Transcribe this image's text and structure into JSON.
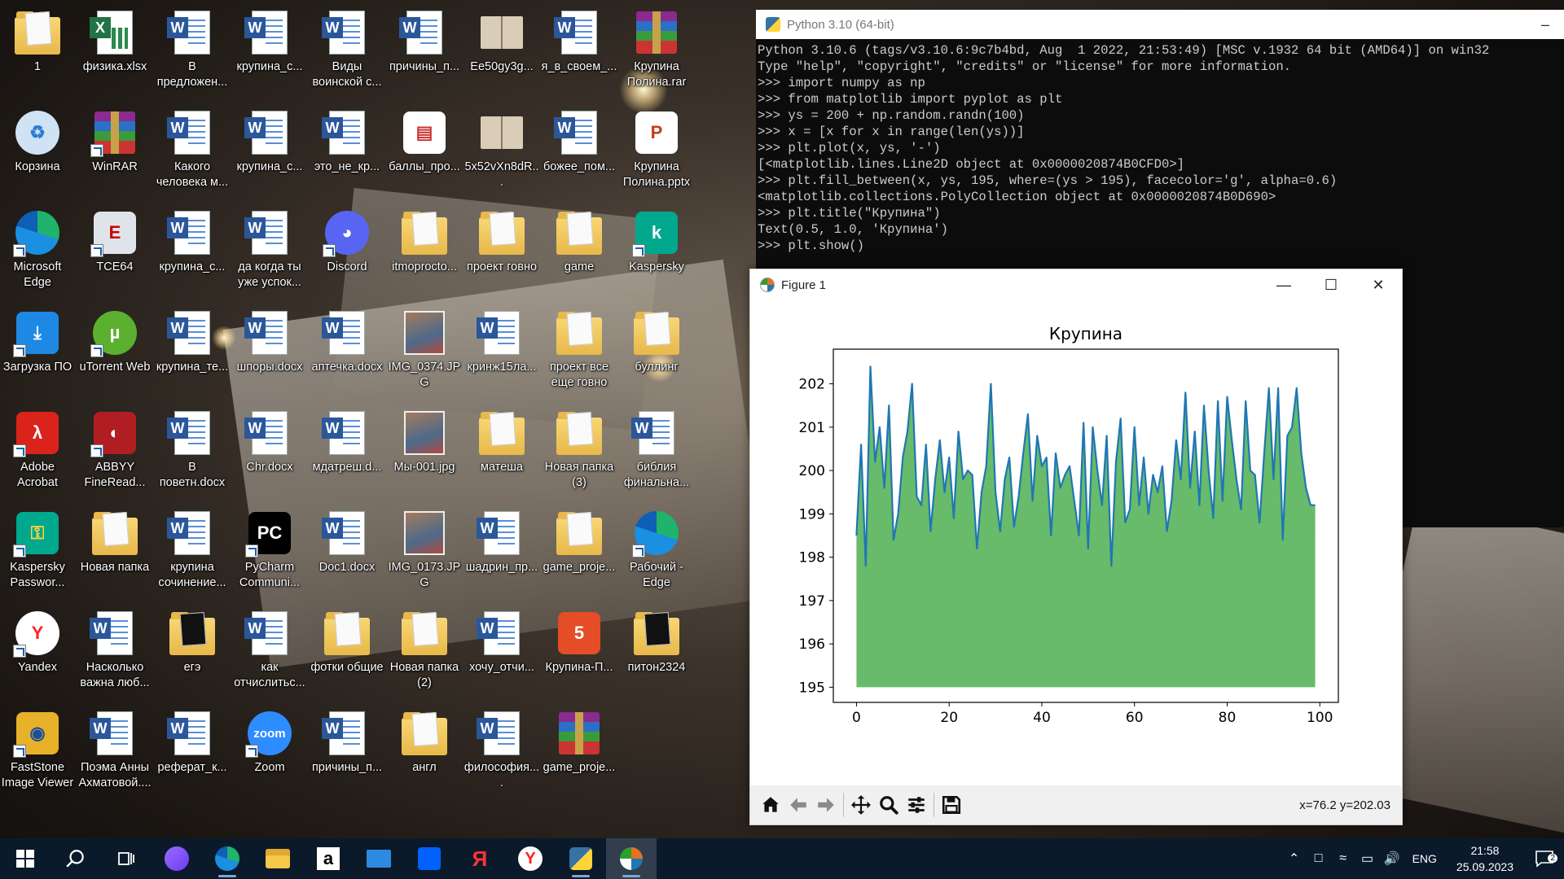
{
  "desktop": {
    "icons": [
      {
        "label": "1",
        "type": "folder"
      },
      {
        "label": "физика.xlsx",
        "type": "excel"
      },
      {
        "label": "В предложен...",
        "type": "word"
      },
      {
        "label": "крупина_с...",
        "type": "word"
      },
      {
        "label": "Виды воинской с...",
        "type": "word"
      },
      {
        "label": "причины_п...",
        "type": "word"
      },
      {
        "label": "Ee50gy3g...",
        "type": "book"
      },
      {
        "label": "я_в_своем_...",
        "type": "word"
      },
      {
        "label": "Крупина Полина.rar",
        "type": "rar"
      },
      {
        "label": "Корзина",
        "type": "recycle"
      },
      {
        "label": "WinRAR",
        "type": "rar",
        "shortcut": true
      },
      {
        "label": "Какого человека м...",
        "type": "word"
      },
      {
        "label": "крупина_с...",
        "type": "word"
      },
      {
        "label": "это_не_кр...",
        "type": "word"
      },
      {
        "label": "баллы_про...",
        "type": "pdfdoc"
      },
      {
        "label": "5x52vXn8dR...",
        "type": "book"
      },
      {
        "label": "божее_пом...",
        "type": "word"
      },
      {
        "label": "Крупина Полина.pptx",
        "type": "pptx"
      },
      {
        "label": "Microsoft Edge",
        "type": "edge",
        "shortcut": true
      },
      {
        "label": "TCE64",
        "type": "tce",
        "shortcut": true
      },
      {
        "label": "крупина_с...",
        "type": "word"
      },
      {
        "label": "да когда ты уже успок...",
        "type": "word"
      },
      {
        "label": "Discord",
        "type": "discord",
        "shortcut": true
      },
      {
        "label": "itmoprocto...",
        "type": "folder"
      },
      {
        "label": "проект говно",
        "type": "folder"
      },
      {
        "label": "game",
        "type": "folder"
      },
      {
        "label": "Kaspersky",
        "type": "kaspersky",
        "shortcut": true
      },
      {
        "label": "Загрузка ПО",
        "type": "download",
        "shortcut": true
      },
      {
        "label": "uTorrent Web",
        "type": "utorrent",
        "shortcut": true
      },
      {
        "label": "крупина_те...",
        "type": "word"
      },
      {
        "label": "шпоры.docx",
        "type": "word"
      },
      {
        "label": "аптечка.docx",
        "type": "word"
      },
      {
        "label": "IMG_0374.JPG",
        "type": "photo"
      },
      {
        "label": "кринж15ла...",
        "type": "word"
      },
      {
        "label": "проект все еще говно",
        "type": "folder"
      },
      {
        "label": "буллинг",
        "type": "folder"
      },
      {
        "label": "Adobe Acrobat",
        "type": "acrobat",
        "shortcut": true
      },
      {
        "label": "ABBYY FineRead...",
        "type": "abbyy",
        "shortcut": true
      },
      {
        "label": "В поветн.docx",
        "type": "word"
      },
      {
        "label": "Chr.docx",
        "type": "word"
      },
      {
        "label": "мдатреш.d...",
        "type": "word"
      },
      {
        "label": "Мы-001.jpg",
        "type": "photo"
      },
      {
        "label": "матеша",
        "type": "folder"
      },
      {
        "label": "Новая папка (3)",
        "type": "folder"
      },
      {
        "label": "библия финальна...",
        "type": "word"
      },
      {
        "label": "Kaspersky Passwor...",
        "type": "kpass",
        "shortcut": true
      },
      {
        "label": "Новая папка",
        "type": "folder"
      },
      {
        "label": "крупина сочинение...",
        "type": "word"
      },
      {
        "label": "PyCharm Communi...",
        "type": "pycharm",
        "shortcut": true
      },
      {
        "label": "Doc1.docx",
        "type": "word"
      },
      {
        "label": "IMG_0173.JPG",
        "type": "photo"
      },
      {
        "label": "шадрин_пр...",
        "type": "word"
      },
      {
        "label": "game_proje...",
        "type": "folder"
      },
      {
        "label": "Рабочий - Edge",
        "type": "edge",
        "shortcut": true
      },
      {
        "label": "Yandex",
        "type": "yandex",
        "shortcut": true
      },
      {
        "label": "Насколько важна люб...",
        "type": "word"
      },
      {
        "label": "егэ",
        "type": "folder-pc"
      },
      {
        "label": "как отчислитьс...",
        "type": "word"
      },
      {
        "label": "фотки общие",
        "type": "folder"
      },
      {
        "label": "Новая папка (2)",
        "type": "folder"
      },
      {
        "label": "хочу_отчи...",
        "type": "word"
      },
      {
        "label": "Крупина-П...",
        "type": "html"
      },
      {
        "label": "питон2324",
        "type": "folder-pc"
      },
      {
        "label": "FastStone Image Viewer",
        "type": "faststone",
        "shortcut": true
      },
      {
        "label": "Поэма Анны Ахматовой....",
        "type": "word"
      },
      {
        "label": "реферат_к...",
        "type": "word"
      },
      {
        "label": "Zoom",
        "type": "zoom",
        "shortcut": true
      },
      {
        "label": "причины_п...",
        "type": "word"
      },
      {
        "label": "англ",
        "type": "folder"
      },
      {
        "label": "философия....",
        "type": "word"
      },
      {
        "label": "game_proje...",
        "type": "rar"
      }
    ]
  },
  "console": {
    "title": "Python 3.10 (64-bit)",
    "lines": [
      "Python 3.10.6 (tags/v3.10.6:9c7b4bd, Aug  1 2022, 21:53:49) [MSC v.1932 64 bit (AMD64)] on win32",
      "Type \"help\", \"copyright\", \"credits\" or \"license\" for more information.",
      ">>> import numpy as np",
      ">>> from matplotlib import pyplot as plt",
      ">>> ys = 200 + np.random.randn(100)",
      ">>> x = [x for x in range(len(ys))]",
      ">>> plt.plot(x, ys, '-')",
      "[<matplotlib.lines.Line2D object at 0x0000020874B0CFD0>]",
      ">>> plt.fill_between(x, ys, 195, where=(ys > 195), facecolor='g', alpha=0.6)",
      "<matplotlib.collections.PolyCollection object at 0x0000020874B0D690>",
      ">>> plt.title(\"Крупина\")",
      "Text(0.5, 1.0, 'Крупина')",
      ">>> plt.show()"
    ]
  },
  "figure": {
    "title": "Figure 1",
    "coords_readout": "x=76.2 y=202.03"
  },
  "chart_data": {
    "type": "area",
    "title": "Крупина",
    "xlabel": "",
    "ylabel": "",
    "xlim": [
      -5,
      104
    ],
    "ylim": [
      194.65,
      202.8
    ],
    "xticks": [
      0,
      20,
      40,
      60,
      80,
      100
    ],
    "yticks": [
      195,
      196,
      197,
      198,
      199,
      200,
      201,
      202
    ],
    "fill_baseline": 195,
    "line_color": "#1f77b4",
    "fill_color": "#4caf50",
    "x": [
      0,
      1,
      2,
      3,
      4,
      5,
      6,
      7,
      8,
      9,
      10,
      11,
      12,
      13,
      14,
      15,
      16,
      17,
      18,
      19,
      20,
      21,
      22,
      23,
      24,
      25,
      26,
      27,
      28,
      29,
      30,
      31,
      32,
      33,
      34,
      35,
      36,
      37,
      38,
      39,
      40,
      41,
      42,
      43,
      44,
      45,
      46,
      47,
      48,
      49,
      50,
      51,
      52,
      53,
      54,
      55,
      56,
      57,
      58,
      59,
      60,
      61,
      62,
      63,
      64,
      65,
      66,
      67,
      68,
      69,
      70,
      71,
      72,
      73,
      74,
      75,
      76,
      77,
      78,
      79,
      80,
      81,
      82,
      83,
      84,
      85,
      86,
      87,
      88,
      89,
      90,
      91,
      92,
      93,
      94,
      95,
      96,
      97,
      98,
      99
    ],
    "values": [
      198.5,
      200.6,
      197.8,
      202.4,
      200.2,
      201.0,
      199.6,
      201.5,
      198.4,
      199.0,
      200.3,
      200.9,
      202.0,
      199.4,
      199.2,
      200.6,
      198.6,
      199.8,
      200.7,
      199.5,
      200.3,
      198.9,
      200.9,
      199.8,
      200.0,
      199.9,
      198.2,
      199.5,
      200.1,
      202.0,
      199.5,
      198.6,
      199.8,
      200.3,
      198.7,
      199.4,
      200.4,
      201.3,
      199.3,
      200.8,
      200.1,
      200.3,
      198.5,
      200.4,
      199.6,
      199.9,
      200.1,
      199.3,
      198.5,
      201.1,
      198.2,
      201.0,
      200.0,
      199.2,
      200.8,
      197.8,
      200.2,
      201.2,
      198.8,
      199.1,
      201.0,
      199.2,
      200.3,
      199.0,
      199.9,
      199.5,
      200.1,
      198.6,
      199.3,
      200.7,
      199.8,
      201.8,
      199.6,
      200.9,
      199.2,
      201.5,
      200.0,
      198.9,
      201.6,
      199.3,
      201.7,
      200.7,
      199.8,
      199.1,
      201.6,
      200.0,
      199.9,
      198.8,
      200.4,
      201.9,
      199.8,
      201.9,
      198.4,
      200.8,
      201.0,
      201.9,
      200.4,
      199.6,
      199.2,
      199.2
    ]
  },
  "taskbar": {
    "items": [
      "start-button",
      "search-button",
      "task-view-button",
      "alice-button",
      "edge-button",
      "explorer-button",
      "amazon-button",
      "mail-button",
      "dropbox-button",
      "yandex-browser-button",
      "yandex-button",
      "python-button",
      "matplotlib-button"
    ],
    "lang": "ENG",
    "time": "21:58",
    "date": "25.09.2023",
    "notifications": "2"
  }
}
